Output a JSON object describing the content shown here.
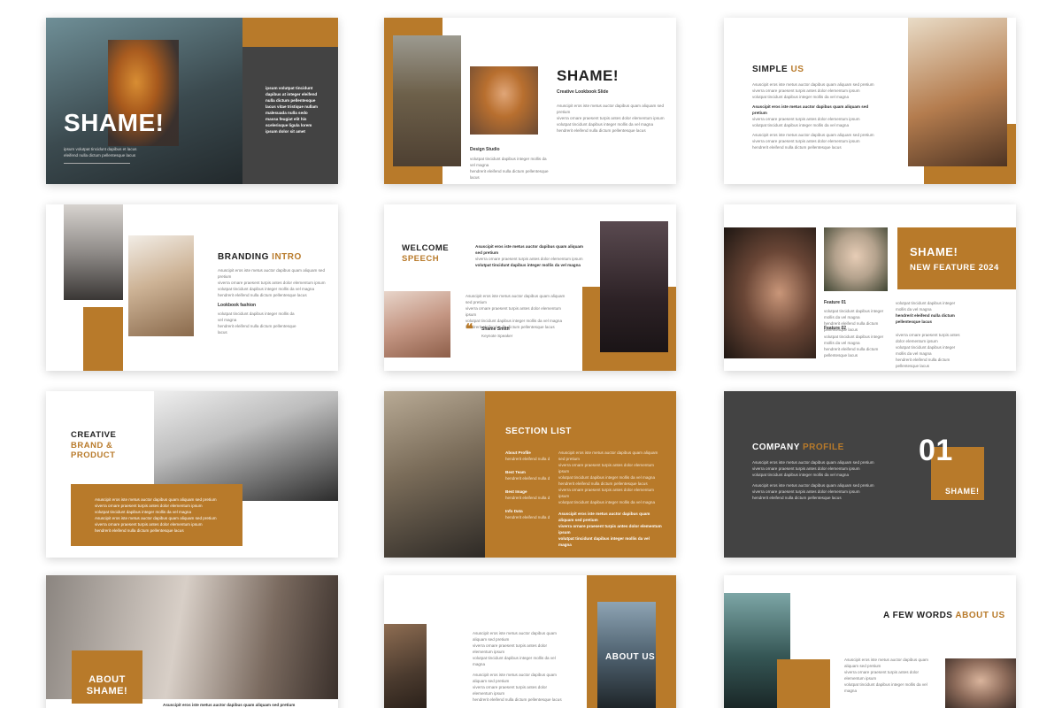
{
  "colors": {
    "accent": "#b87a2a",
    "dark": "#434343"
  },
  "lorem": {
    "short": "Asuscipit eros iste metus auctor dapibus quam aliquam sed pretium",
    "line2": "viverra ornare praesent turpis antes dolor elementum ipsum",
    "line3": "volutpat tincidunt dapibus integer mollis da vel magna",
    "line4": "hendrerit eleifend nulla dictum pellentesque lacus"
  },
  "s1": {
    "title": "SHAME!",
    "caption1": "ipsum volutpat tincidunt dapibus et lacus",
    "caption2": "eleifend nulla dictum pellentesque lacus",
    "side": [
      "ipsum volutpat tincidunt",
      "dapibus at integer eleifend",
      "nulla dictum pellentesque",
      "lacus vitae tristique nullam",
      "malesuada nulla sedo",
      "massa feugiat elit his",
      "scelerisque ligula lorem",
      "ipsum dolor sit amet"
    ]
  },
  "s2": {
    "title": "SHAME!",
    "subtitle": "Creative Lookbook Slide",
    "label": "Design Studio"
  },
  "s3": {
    "title_a": "SIMPLE",
    "title_b": "US"
  },
  "s4": {
    "title_a": "BRANDING",
    "title_b": "INTRO",
    "label": "Lookbook fashion"
  },
  "s5": {
    "title_a": "WELCOME",
    "title_b": "SPEECH",
    "name": "Shame Smith",
    "role": "Keynote Speaker"
  },
  "s6": {
    "title": "SHAME!",
    "subtitle": "NEW FEATURE 2024",
    "feature1": "Feature 01",
    "feature2": "Feature 02"
  },
  "s7": {
    "title_a": "CREATIVE",
    "title_b": "BRAND &",
    "title_c": "PRODUCT"
  },
  "s8": {
    "title": "SECTION LIST",
    "items": [
      "About Profile",
      "Best Team",
      "Best Image",
      "Info Data"
    ]
  },
  "s9": {
    "title_a": "COMPANY",
    "title_b": "PROFILE",
    "number": "01",
    "badge": "SHAME!"
  },
  "s10": {
    "title_a": "ABOUT",
    "title_b": "SHAME!"
  },
  "s11": {
    "title": "ABOUT US"
  },
  "s12": {
    "title_a": "A FEW WORDS",
    "title_b": "ABOUT US"
  }
}
